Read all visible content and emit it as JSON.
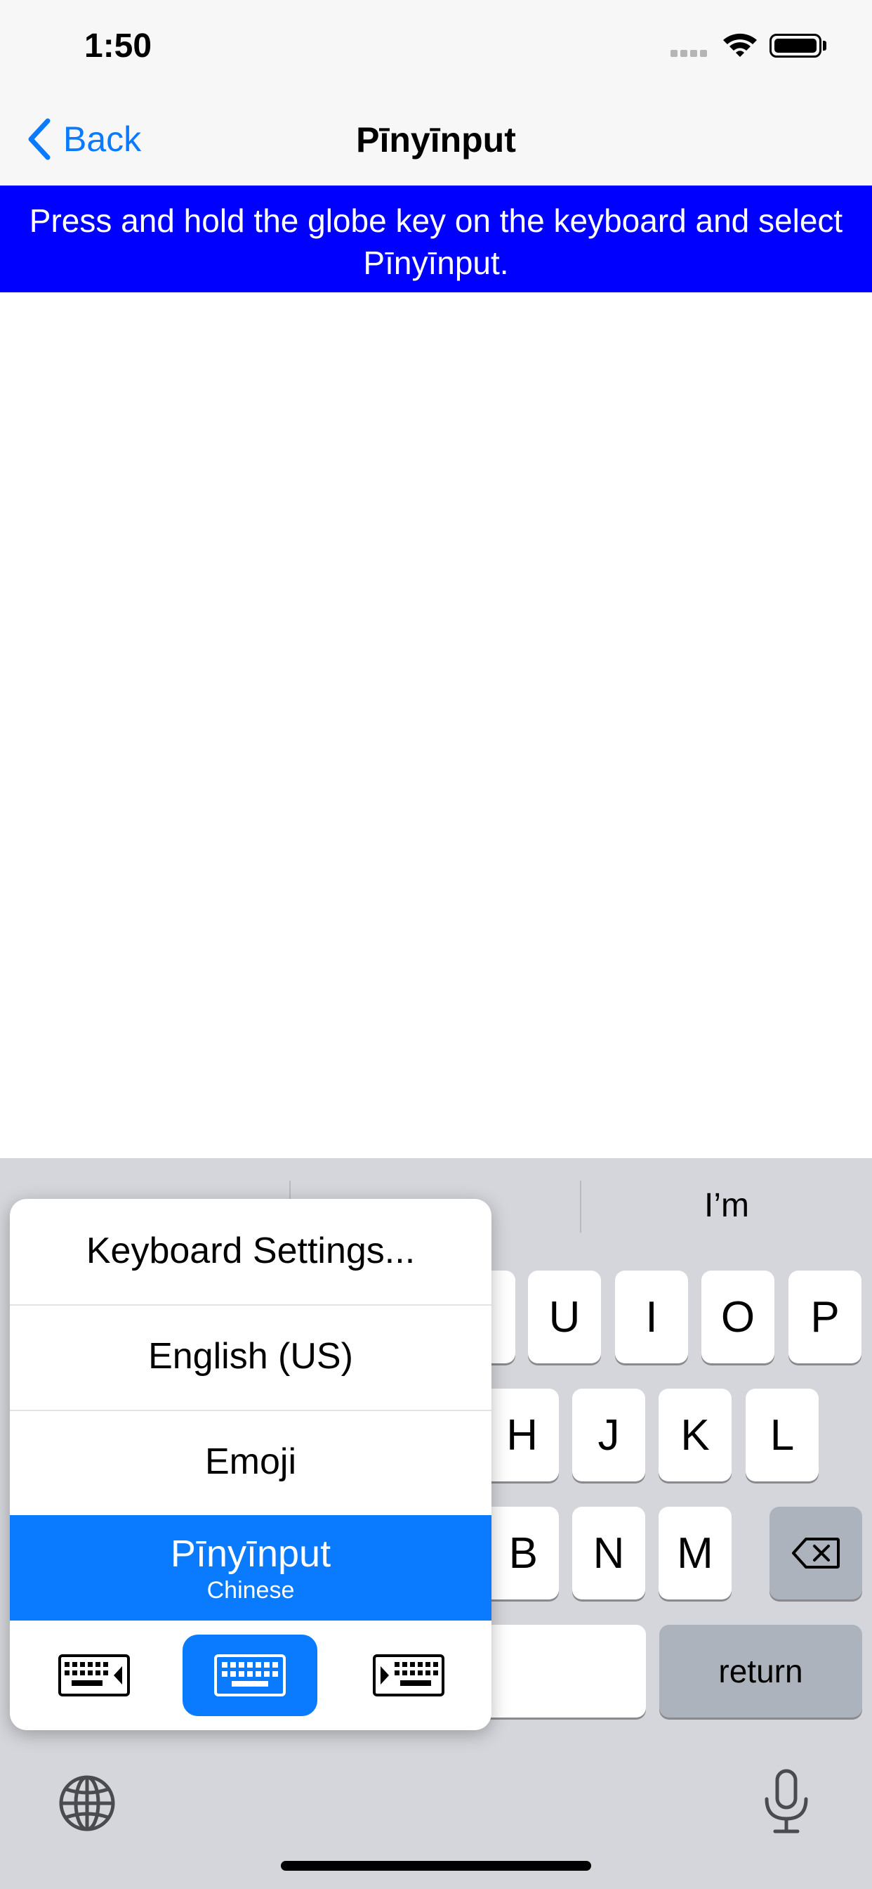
{
  "status_bar": {
    "time": "1:50"
  },
  "nav": {
    "back_label": "Back",
    "title": "Pīnyīnput"
  },
  "banner": {
    "text": "Press and hold the globe key on the keyboard and select Pīnyīnput."
  },
  "keyboard": {
    "prediction_right": "I’m",
    "row1": [
      "U",
      "I",
      "O",
      "P"
    ],
    "row2": [
      "H",
      "J",
      "K",
      "L"
    ],
    "row3": [
      "B",
      "N",
      "M"
    ],
    "return_label": "return"
  },
  "popup": {
    "items": [
      "Keyboard Settings...",
      "English (US)",
      "Emoji"
    ],
    "selected_title": "Pīnyīnput",
    "selected_subtitle": "Chinese"
  },
  "colors": {
    "accent": "#0a7aff",
    "banner": "#0000ff",
    "keyboard_bg": "#d5d6db"
  },
  "icons": [
    "chevron-left-icon",
    "wifi-icon",
    "battery-icon",
    "globe-icon",
    "microphone-icon",
    "delete-icon",
    "keyboard-left-icon",
    "keyboard-icon",
    "keyboard-right-icon"
  ]
}
